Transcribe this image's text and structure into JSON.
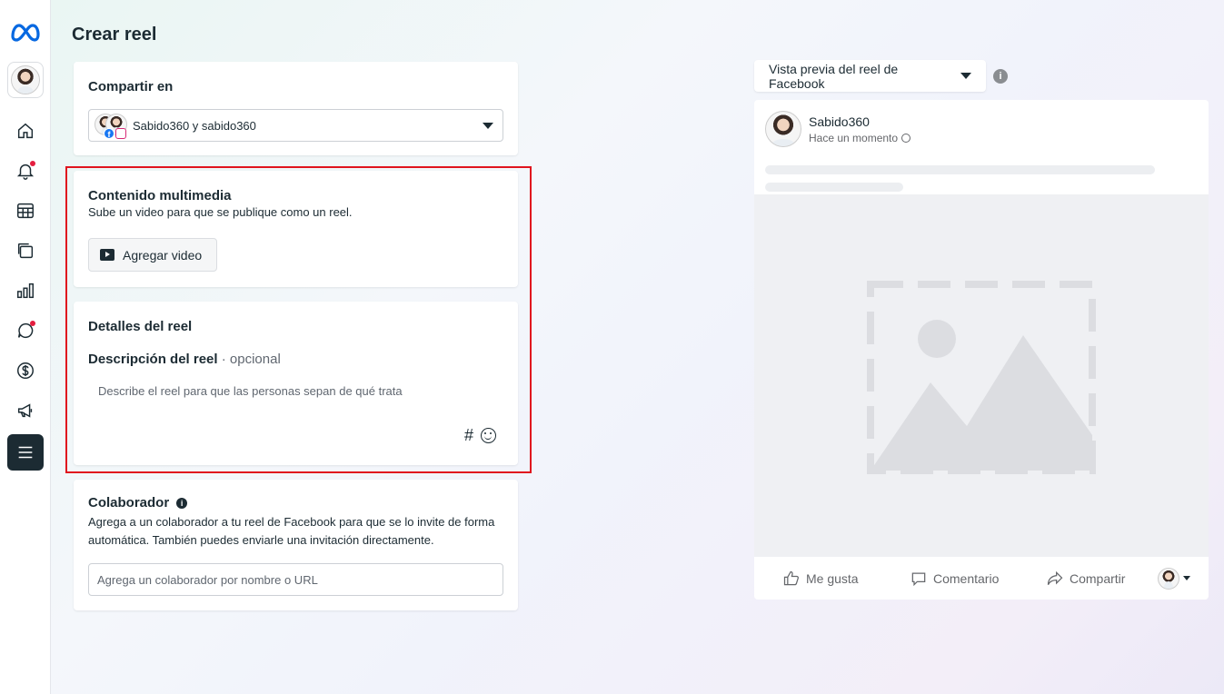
{
  "sidebar": {
    "logo_icon": "meta-logo-icon",
    "items": [
      {
        "name": "home",
        "icon": "home-icon"
      },
      {
        "name": "notifications",
        "icon": "bell-icon",
        "badge": true
      },
      {
        "name": "planner",
        "icon": "grid-table-icon"
      },
      {
        "name": "content",
        "icon": "stacked-pages-icon"
      },
      {
        "name": "insights",
        "icon": "bar-chart-icon"
      },
      {
        "name": "inbox",
        "icon": "chat-bubble-icon",
        "badge": true
      },
      {
        "name": "monetization",
        "icon": "dollar-icon"
      },
      {
        "name": "ads",
        "icon": "megaphone-icon"
      },
      {
        "name": "menu",
        "icon": "hamburger-menu-icon"
      }
    ]
  },
  "page": {
    "title": "Crear reel"
  },
  "share": {
    "title": "Compartir en",
    "selected": "Sabido360 y sabido360"
  },
  "media": {
    "title": "Contenido multimedia",
    "subtitle": "Sube un video para que se publique como un reel.",
    "add_video_label": "Agregar video"
  },
  "details": {
    "title": "Detalles del reel",
    "desc_label": "Descripción del reel",
    "desc_optional": "· opcional",
    "desc_placeholder": "Describe el reel para que las personas sepan de qué trata",
    "hashtag": "#"
  },
  "collab": {
    "title": "Colaborador",
    "info": "i",
    "description": "Agrega a un colaborador a tu reel de Facebook para que se lo invite de forma automática. También puedes enviarle una invitación directamente.",
    "placeholder": "Agrega un colaborador por nombre o URL"
  },
  "preview": {
    "selector_label": "Vista previa del reel de Facebook",
    "info": "i",
    "post": {
      "name": "Sabido360",
      "time": "Hace un momento",
      "actions": {
        "like": "Me gusta",
        "comment": "Comentario",
        "share": "Compartir"
      }
    }
  },
  "colors": {
    "highlight": "#e0141e",
    "meta_blue": "#0668e1",
    "text": "#1c2b33"
  }
}
